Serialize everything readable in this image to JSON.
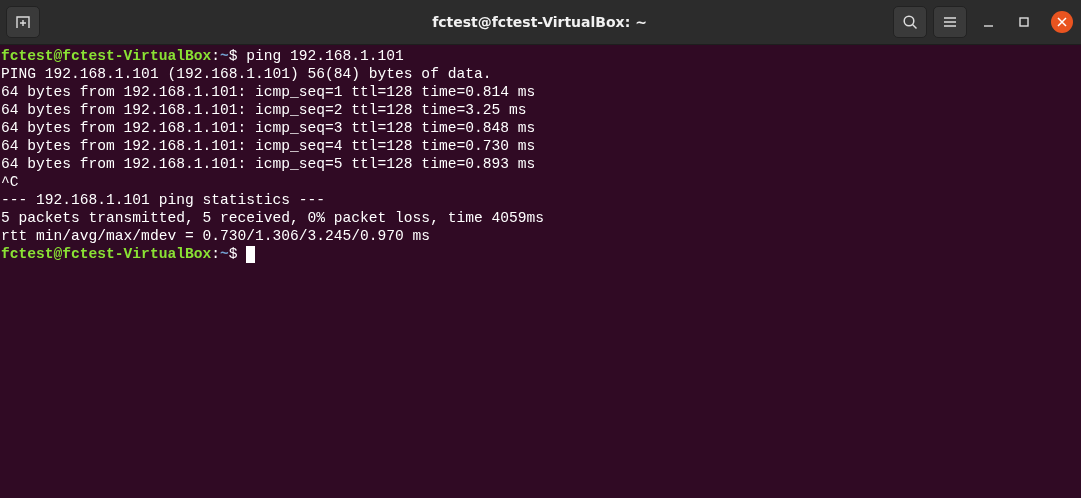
{
  "window": {
    "title": "fctest@fctest-VirtualBox: ~"
  },
  "terminal": {
    "lines": [
      {
        "kind": "prompt",
        "user": "fctest@fctest-VirtualBox",
        "separator": ":",
        "path": "~",
        "symbol": "$",
        "command": "ping 192.168.1.101"
      },
      {
        "kind": "output",
        "text": "PING 192.168.1.101 (192.168.1.101) 56(84) bytes of data."
      },
      {
        "kind": "output",
        "text": "64 bytes from 192.168.1.101: icmp_seq=1 ttl=128 time=0.814 ms"
      },
      {
        "kind": "output",
        "text": "64 bytes from 192.168.1.101: icmp_seq=2 ttl=128 time=3.25 ms"
      },
      {
        "kind": "output",
        "text": "64 bytes from 192.168.1.101: icmp_seq=3 ttl=128 time=0.848 ms"
      },
      {
        "kind": "output",
        "text": "64 bytes from 192.168.1.101: icmp_seq=4 ttl=128 time=0.730 ms"
      },
      {
        "kind": "output",
        "text": "64 bytes from 192.168.1.101: icmp_seq=5 ttl=128 time=0.893 ms"
      },
      {
        "kind": "output",
        "text": "^C"
      },
      {
        "kind": "output",
        "text": "--- 192.168.1.101 ping statistics ---"
      },
      {
        "kind": "output",
        "text": "5 packets transmitted, 5 received, 0% packet loss, time 4059ms"
      },
      {
        "kind": "output",
        "text": "rtt min/avg/max/mdev = 0.730/1.306/3.245/0.970 ms"
      },
      {
        "kind": "prompt",
        "user": "fctest@fctest-VirtualBox",
        "separator": ":",
        "path": "~",
        "symbol": "$",
        "cursor": true
      }
    ]
  }
}
